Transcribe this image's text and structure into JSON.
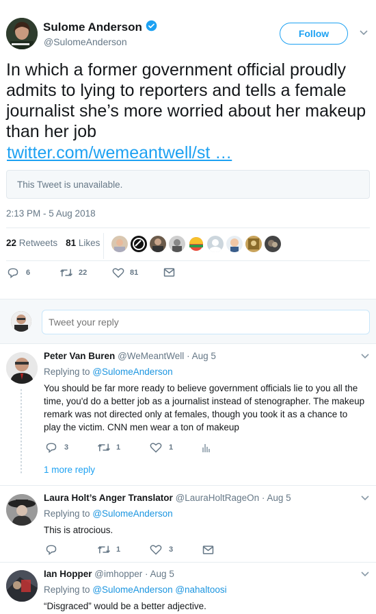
{
  "main_tweet": {
    "author_name": "Sulome Anderson",
    "author_handle": "@SulomeAnderson",
    "follow_label": "Follow",
    "text": "In which a former government official proudly admits to lying to reporters and tells a female journalist she’s more worried about her makeup than her job",
    "link_text": "twitter.com/wemeantwell/st …",
    "quoted_unavailable": "This Tweet is unavailable.",
    "timestamp": "2:13 PM - 5 Aug 2018",
    "retweets_count": "22",
    "retweets_label": "Retweets",
    "likes_count": "81",
    "likes_label": "Likes",
    "actions": {
      "replies": "6",
      "retweets": "22",
      "likes": "81"
    }
  },
  "reply_box": {
    "placeholder": "Tweet your reply"
  },
  "replies": [
    {
      "name": "Peter Van Buren",
      "handle": "@WeMeantWell",
      "date": "· Aug 5",
      "replying_prefix": "Replying to",
      "replying_to": "@SulomeAnderson",
      "text": "You should be far more ready to believe government officials lie to you all the time, you'd do a better job as a journalist instead of stenographer. The makeup remark was not directed only at females, though you took it as a chance to play the victim. CNN men wear a ton of makeup",
      "actions": {
        "replies": "3",
        "retweets": "1",
        "likes": "1"
      },
      "more_replies": "1 more reply"
    },
    {
      "name": "Laura Holt’s Anger Translator",
      "handle": "@LauraHoltRageOn",
      "date": "· Aug 5",
      "replying_prefix": "Replying to",
      "replying_to": "@SulomeAnderson",
      "text": "This is atrocious.",
      "actions": {
        "replies": "",
        "retweets": "1",
        "likes": "3"
      }
    },
    {
      "name": "Ian Hopper",
      "handle": "@imhopper",
      "date": "· Aug 5",
      "replying_prefix": "Replying to",
      "replying_to": "@SulomeAnderson @nahaltoosi",
      "text": "“Disgraced” would be a better adjective."
    }
  ],
  "colors": {
    "accent": "#1da1f2",
    "verified": "#1da1f2",
    "muted": "#657786",
    "border": "#e6ecf0"
  }
}
